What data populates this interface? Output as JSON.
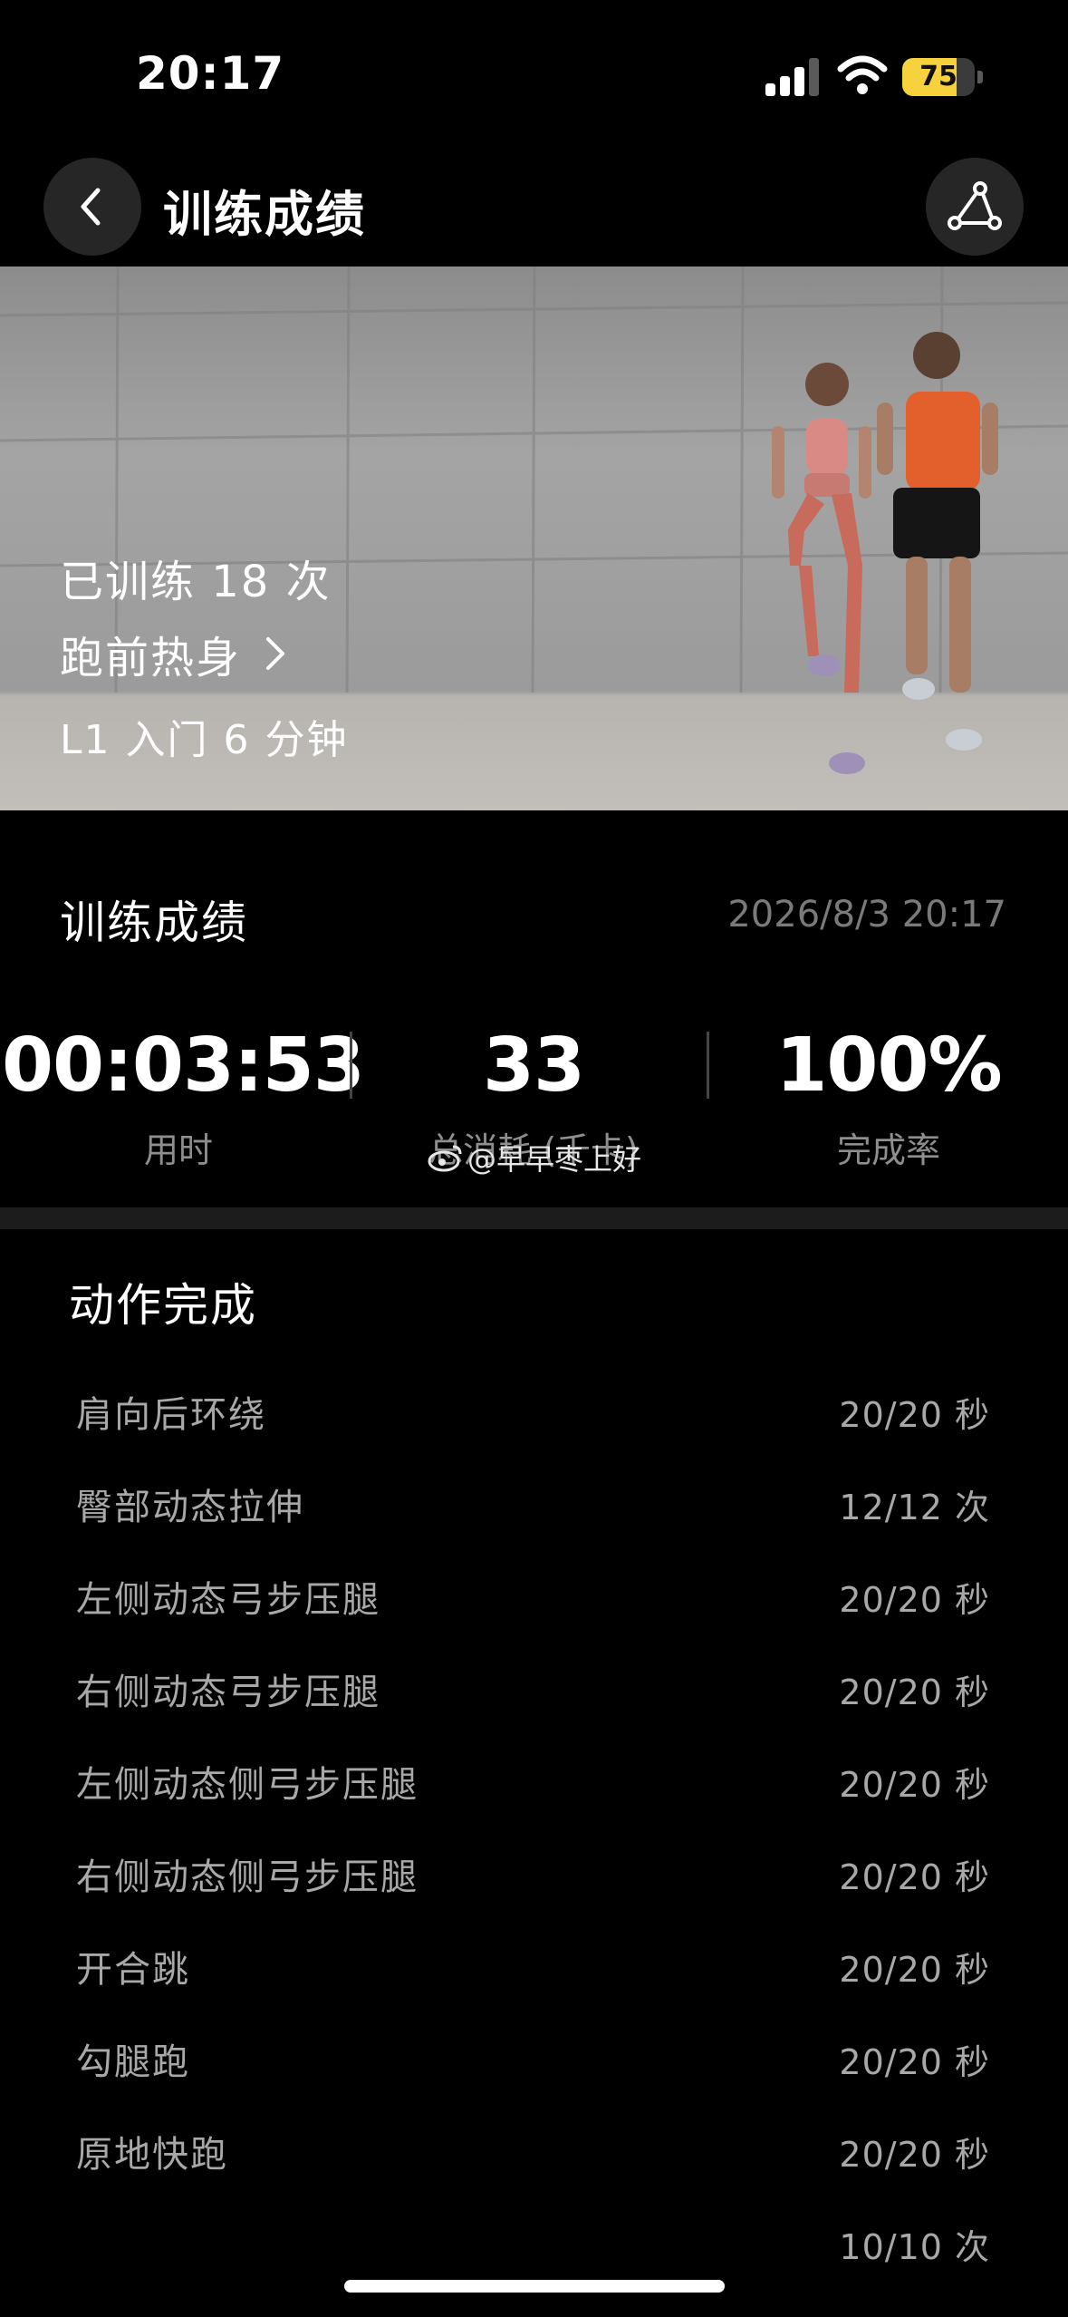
{
  "status_bar": {
    "time": "20:17",
    "battery_percent": "75",
    "battery_level": 0.75,
    "signal_bars_active": 3,
    "signal_bars_total": 4
  },
  "nav": {
    "title": "训练成绩",
    "back_icon": "chevron-left-icon",
    "share_icon": "share-icon"
  },
  "hero": {
    "times_trained": "已训练 18 次",
    "course_name": "跑前热身",
    "level": "L1 入门 6 分钟"
  },
  "results": {
    "title": "训练成绩",
    "date": "2026/8/3 20:17",
    "stats": [
      {
        "value": "00:03:53",
        "label": "用时"
      },
      {
        "value": "33",
        "label": "总消耗 (千卡)"
      },
      {
        "value": "100%",
        "label": "完成率"
      }
    ]
  },
  "watermark": "@早早枣上好",
  "exercises": {
    "title": "动作完成",
    "items": [
      {
        "name": "肩向后环绕",
        "amount": "20/20 秒"
      },
      {
        "name": "臀部动态拉伸",
        "amount": "12/12 次"
      },
      {
        "name": "左侧动态弓步压腿",
        "amount": "20/20 秒"
      },
      {
        "name": "右侧动态弓步压腿",
        "amount": "20/20 秒"
      },
      {
        "name": "左侧动态侧弓步压腿",
        "amount": "20/20 秒"
      },
      {
        "name": "右侧动态侧弓步压腿",
        "amount": "20/20 秒"
      },
      {
        "name": "开合跳",
        "amount": "20/20 秒"
      },
      {
        "name": "勾腿跑",
        "amount": "20/20 秒"
      },
      {
        "name": "原地快跑",
        "amount": "20/20 秒"
      },
      {
        "name": "",
        "amount": "10/10 次"
      }
    ]
  }
}
